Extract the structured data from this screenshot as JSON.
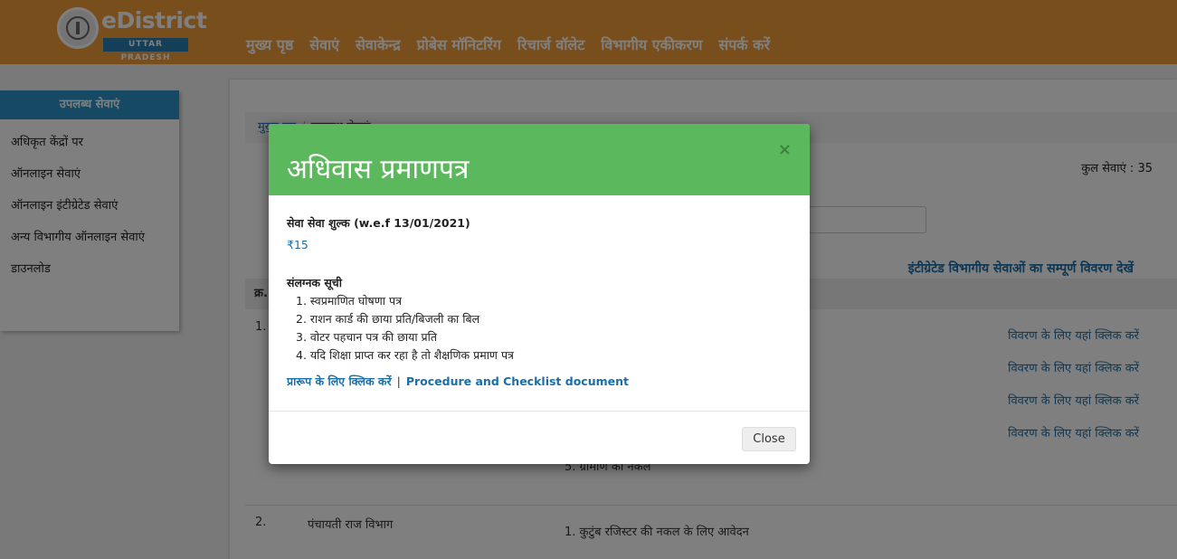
{
  "header": {
    "logo_title": "eDistrict",
    "logo_subtitle": "UTTAR PRADESH",
    "nav": [
      "मुख्य पृष्ठ",
      "सेवाएं",
      "सेवाकेन्द्र",
      "प्रोबेस मॉनिटरिंग",
      "रिचार्ज वॉलेट",
      "विभागीय एकीकरण",
      "संपर्क करें"
    ]
  },
  "sidebar": {
    "title": "उपलब्ध सेवाएं",
    "items": [
      "अधिकृत केंद्रों पर",
      "ऑनलाइन सेवाएं",
      "ऑनलाइन इंटीग्रेटेड सेवाएं",
      "अन्य विभागीय ऑनलाइन सेवाएं",
      "डाउनलोड"
    ]
  },
  "main": {
    "breadcrumb_home": "मुख्य पृष्ठ",
    "breadcrumb_current": "उपलब्ध सेवाएं",
    "total_services": "कुल सेवाएं : 35",
    "integrated_link": "इंटीग्रेटेड विभागीय सेवाओं का सम्पूर्ण विवरण देखें",
    "table_head_no": "क्र.",
    "row1_no": "1.",
    "detail_link": "विवरण के लिए यहां क्लिक करें",
    "row1_partial": "5. ग्रामीण की नकल",
    "row2_no": "2.",
    "row2_dept": "पंचायती राज विभाग",
    "row2_service": "1. कुटुंब रजिस्टर की नकल के लिए आवेदन"
  },
  "modal": {
    "title": "अधिवास प्रमाणपत्र",
    "close_x": "×",
    "fee_label": "सेवा सेवा शुल्क (w.e.f 13/01/2021)",
    "fee_value": "₹15",
    "attachments_label": "संलग्नक सूची",
    "attachments": [
      "1. स्वप्रमाणित घोषणा पत्र",
      "2. राशन कार्ड की छाया प्रति/बिजली का बिल",
      "3. वोटर पहचान पत्र की छाया प्रति",
      "4. यदि शिक्षा प्राप्त कर रहा है तो शैक्षणिक प्रमाण पत्र"
    ],
    "form_link": "प्रारूप के लिए क्लिक करें",
    "separator": "|",
    "procedure_link": "Procedure and Checklist document",
    "close_button": "Close"
  }
}
